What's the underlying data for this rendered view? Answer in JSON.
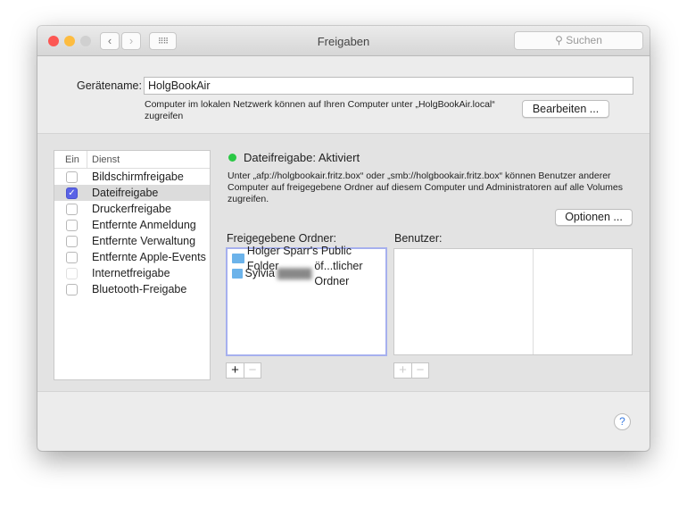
{
  "window": {
    "title": "Freigaben",
    "search_placeholder": "Suchen"
  },
  "colors": {
    "close": "#fc5753",
    "minimize": "#fdbc40",
    "accent": "#5a63e6",
    "status_on": "#2ac845"
  },
  "device": {
    "label": "Gerätename:",
    "value": "HolgBookAir",
    "note": "Computer im lokalen Netzwerk können auf Ihren Computer unter „HolgBookAir.local“ zugreifen",
    "edit_button": "Bearbeiten ..."
  },
  "services": {
    "col_on": "Ein",
    "col_service": "Dienst",
    "items": [
      {
        "label": "Bildschirmfreigabe",
        "checked": false
      },
      {
        "label": "Dateifreigabe",
        "checked": true
      },
      {
        "label": "Druckerfreigabe",
        "checked": false
      },
      {
        "label": "Entfernte Anmeldung",
        "checked": false
      },
      {
        "label": "Entfernte Verwaltung",
        "checked": false
      },
      {
        "label": "Entfernte Apple-Events",
        "checked": false
      },
      {
        "label": "Internetfreigabe",
        "checked": false
      },
      {
        "label": "Bluetooth-Freigabe",
        "checked": false
      }
    ]
  },
  "detail": {
    "status": "Dateifreigabe: Aktiviert",
    "description": "Unter „afp://holgbookair.fritz.box“ oder „smb://holgbookair.fritz.box“ können Benutzer anderer Computer auf freigegebene Ordner auf diesem Computer und Administratoren auf alle Volumes zugreifen.",
    "options_button": "Optionen ...",
    "folders_label": "Freigegebene Ordner:",
    "users_label": "Benutzer:",
    "folders": [
      {
        "name": "Holger Sparr's Public Folder"
      },
      {
        "name_start": "Sylvia",
        "name_end": "öf...tlicher Ordner"
      }
    ],
    "add": "+",
    "remove": "−"
  },
  "help": "?"
}
